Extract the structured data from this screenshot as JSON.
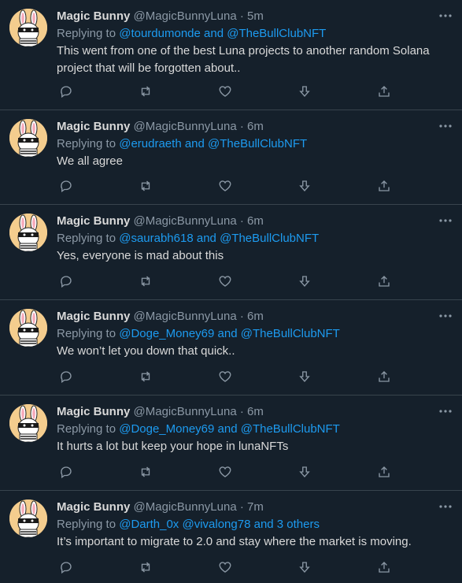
{
  "colors": {
    "background": "#15202b",
    "text": "#d9d9d9",
    "muted": "#8b98a5",
    "accent": "#1d9bf0",
    "divider": "#38444d"
  },
  "icons": {
    "reply": "reply-icon",
    "retweet": "retweet-icon",
    "like": "like-icon",
    "vote": "downvote-icon",
    "share": "share-icon",
    "more": "more-options-icon"
  },
  "tweets": [
    {
      "name": "Magic Bunny",
      "handle": "@MagicBunnyLuna",
      "sep": "·",
      "time": "5m",
      "replying_prefix": "Replying to ",
      "mention_1": "@tourdumonde",
      "and": " and ",
      "mention_2": "@TheBullClubNFT",
      "text": "This went from one of the best Luna projects to another random Solana project that will be forgotten about.."
    },
    {
      "name": "Magic Bunny",
      "handle": "@MagicBunnyLuna",
      "sep": "·",
      "time": "6m",
      "replying_prefix": "Replying to ",
      "mention_1": "@erudraeth",
      "and": " and ",
      "mention_2": "@TheBullClubNFT",
      "text": "We all agree"
    },
    {
      "name": "Magic Bunny",
      "handle": "@MagicBunnyLuna",
      "sep": "·",
      "time": "6m",
      "replying_prefix": "Replying to ",
      "mention_1": "@saurabh618",
      "and": " and ",
      "mention_2": "@TheBullClubNFT",
      "text": "Yes, everyone is mad about this"
    },
    {
      "name": "Magic Bunny",
      "handle": "@MagicBunnyLuna",
      "sep": "·",
      "time": "6m",
      "replying_prefix": "Replying to ",
      "mention_1": "@Doge_Money69",
      "and": " and ",
      "mention_2": "@TheBullClubNFT",
      "text": "We won’t let you down that quick.."
    },
    {
      "name": "Magic Bunny",
      "handle": "@MagicBunnyLuna",
      "sep": "·",
      "time": "6m",
      "replying_prefix": "Replying to ",
      "mention_1": "@Doge_Money69",
      "and": " and ",
      "mention_2": "@TheBullClubNFT",
      "text": "It hurts a lot but keep your hope in lunaNFTs"
    },
    {
      "name": "Magic Bunny",
      "handle": "@MagicBunnyLuna",
      "sep": "·",
      "time": "7m",
      "replying_prefix": "Replying to ",
      "mention_1": "@Darth_0x",
      "and": " ",
      "mention_2": "@vivalong78 and 3 others",
      "text": "It’s important to migrate to 2.0 and stay where the market is moving."
    }
  ]
}
